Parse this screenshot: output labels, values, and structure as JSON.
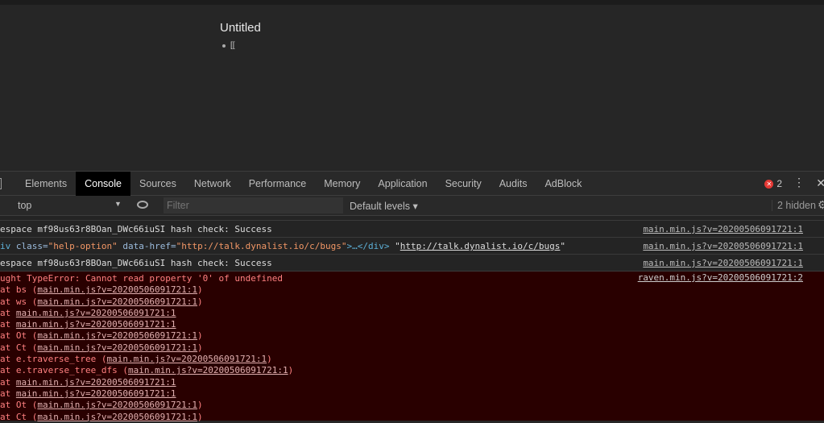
{
  "page": {
    "title": "Untitled",
    "bullet_text": "[["
  },
  "devtools": {
    "tabs": [
      "Elements",
      "Console",
      "Sources",
      "Network",
      "Performance",
      "Memory",
      "Application",
      "Security",
      "Audits",
      "AdBlock"
    ],
    "active_tab": "Console",
    "error_count": "2",
    "context": "top",
    "filter_placeholder": "Filter",
    "levels": "Default levels",
    "hidden": "2 hidden"
  },
  "console": {
    "rows": [
      {
        "text": "espace mf98us63r8BOan_DWc66iuSI hash check: Success",
        "source": "main.min.js?v=20200506091721:1"
      },
      {
        "tag_open": "iv ",
        "attr1": "class=",
        "val1": "\"help-option\"",
        "attr2": " data-href=",
        "val2": "\"http://talk.dynalist.io/c/bugs\"",
        "tag_close": ">…</div>",
        "after": " \"",
        "link": "http://talk.dynalist.io/c/bugs",
        "after2": "\"",
        "source": "main.min.js?v=20200506091721:1"
      },
      {
        "text": "espace mf98us63r8BOan_DWc66iuSI hash check: Success",
        "source": "main.min.js?v=20200506091721:1"
      }
    ],
    "error": {
      "message": "ught TypeError: Cannot read property '0' of undefined",
      "source": "raven.min.js?v=20200506091721:2",
      "stack": [
        {
          "pre": "at bs (",
          "link": "main.min.js?v=20200506091721:1",
          "post": ")"
        },
        {
          "pre": "at ws (",
          "link": "main.min.js?v=20200506091721:1",
          "post": ")"
        },
        {
          "pre": "at ",
          "link": "main.min.js?v=20200506091721:1",
          "post": ""
        },
        {
          "pre": "at ",
          "link": "main.min.js?v=20200506091721:1",
          "post": ""
        },
        {
          "pre": "at Ot (",
          "link": "main.min.js?v=20200506091721:1",
          "post": ")"
        },
        {
          "pre": "at Ct (",
          "link": "main.min.js?v=20200506091721:1",
          "post": ")"
        },
        {
          "pre": "at e.traverse_tree (",
          "link": "main.min.js?v=20200506091721:1",
          "post": ")"
        },
        {
          "pre": "at e.traverse_tree_dfs (",
          "link": "main.min.js?v=20200506091721:1",
          "post": ")"
        },
        {
          "pre": "at ",
          "link": "main.min.js?v=20200506091721:1",
          "post": ""
        },
        {
          "pre": "at ",
          "link": "main.min.js?v=20200506091721:1",
          "post": ""
        },
        {
          "pre": "at Ot (",
          "link": "main.min.js?v=20200506091721:1",
          "post": ")"
        },
        {
          "pre": "at Ct (",
          "link": "main.min.js?v=20200506091721:1",
          "post": ")"
        }
      ]
    }
  }
}
